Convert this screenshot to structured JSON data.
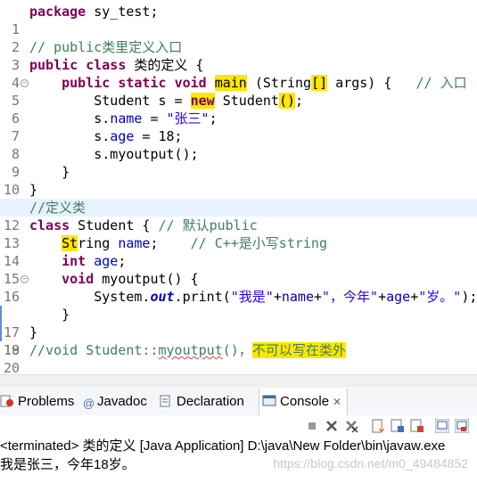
{
  "editor": {
    "lines": [
      {
        "n": "1",
        "code": "package sy_test;"
      },
      {
        "n": "2",
        "code": ""
      },
      {
        "n": "3",
        "code": "// public类里定义入口"
      },
      {
        "n": "4",
        "code": "public class 类的定义 {"
      },
      {
        "n": "5",
        "code": "    public static void main (String[] args) {   // 入口"
      },
      {
        "n": "6",
        "code": "        Student s = new Student();"
      },
      {
        "n": "7",
        "code": "        s.name = \"张三\";"
      },
      {
        "n": "8",
        "code": "        s.age = 18;"
      },
      {
        "n": "9",
        "code": "        s.myoutput();"
      },
      {
        "n": "10",
        "code": "    }"
      },
      {
        "n": "11",
        "code": "}"
      },
      {
        "n": "12",
        "code": "//定义类"
      },
      {
        "n": "13",
        "code": "class Student { // 默认public"
      },
      {
        "n": "14",
        "code": "    String name;    // C++是小写string"
      },
      {
        "n": "15",
        "code": "    int age;"
      },
      {
        "n": "16",
        "code": "    void myoutput() {"
      },
      {
        "n": "17",
        "code": "        System.out.print(\"我是\"+name+\"，今年\"+age+\"岁。\");"
      },
      {
        "n": "18",
        "code": "    }"
      },
      {
        "n": "19",
        "code": "}"
      },
      {
        "n": "20",
        "code": "//void Student::myoutput()，不可以写在类外"
      }
    ],
    "current_line": 12,
    "fold_markers": [
      "5",
      "16"
    ]
  },
  "views": {
    "tabs": [
      {
        "label": "Problems",
        "icon": "problems-icon"
      },
      {
        "label": "Javadoc",
        "icon": "at-sign-icon"
      },
      {
        "label": "Declaration",
        "icon": "declaration-icon"
      },
      {
        "label": "Console",
        "icon": "console-icon",
        "close": "✕"
      }
    ],
    "active_tab": "Console"
  },
  "console": {
    "header": "<terminated> 类的定义 [Java Application] D:\\java\\New Folder\\bin\\javaw.exe",
    "output": "我是张三，今年18岁。",
    "watermark": "https://blog.csdn.net/m0_49484852"
  },
  "toolbar_icons": [
    "terminate-icon",
    "remove-launch-icon",
    "remove-all-icon",
    "scroll-lock-icon",
    "show-stdout-icon",
    "show-stderr-icon",
    "pin-console-icon",
    "display-console-icon"
  ]
}
